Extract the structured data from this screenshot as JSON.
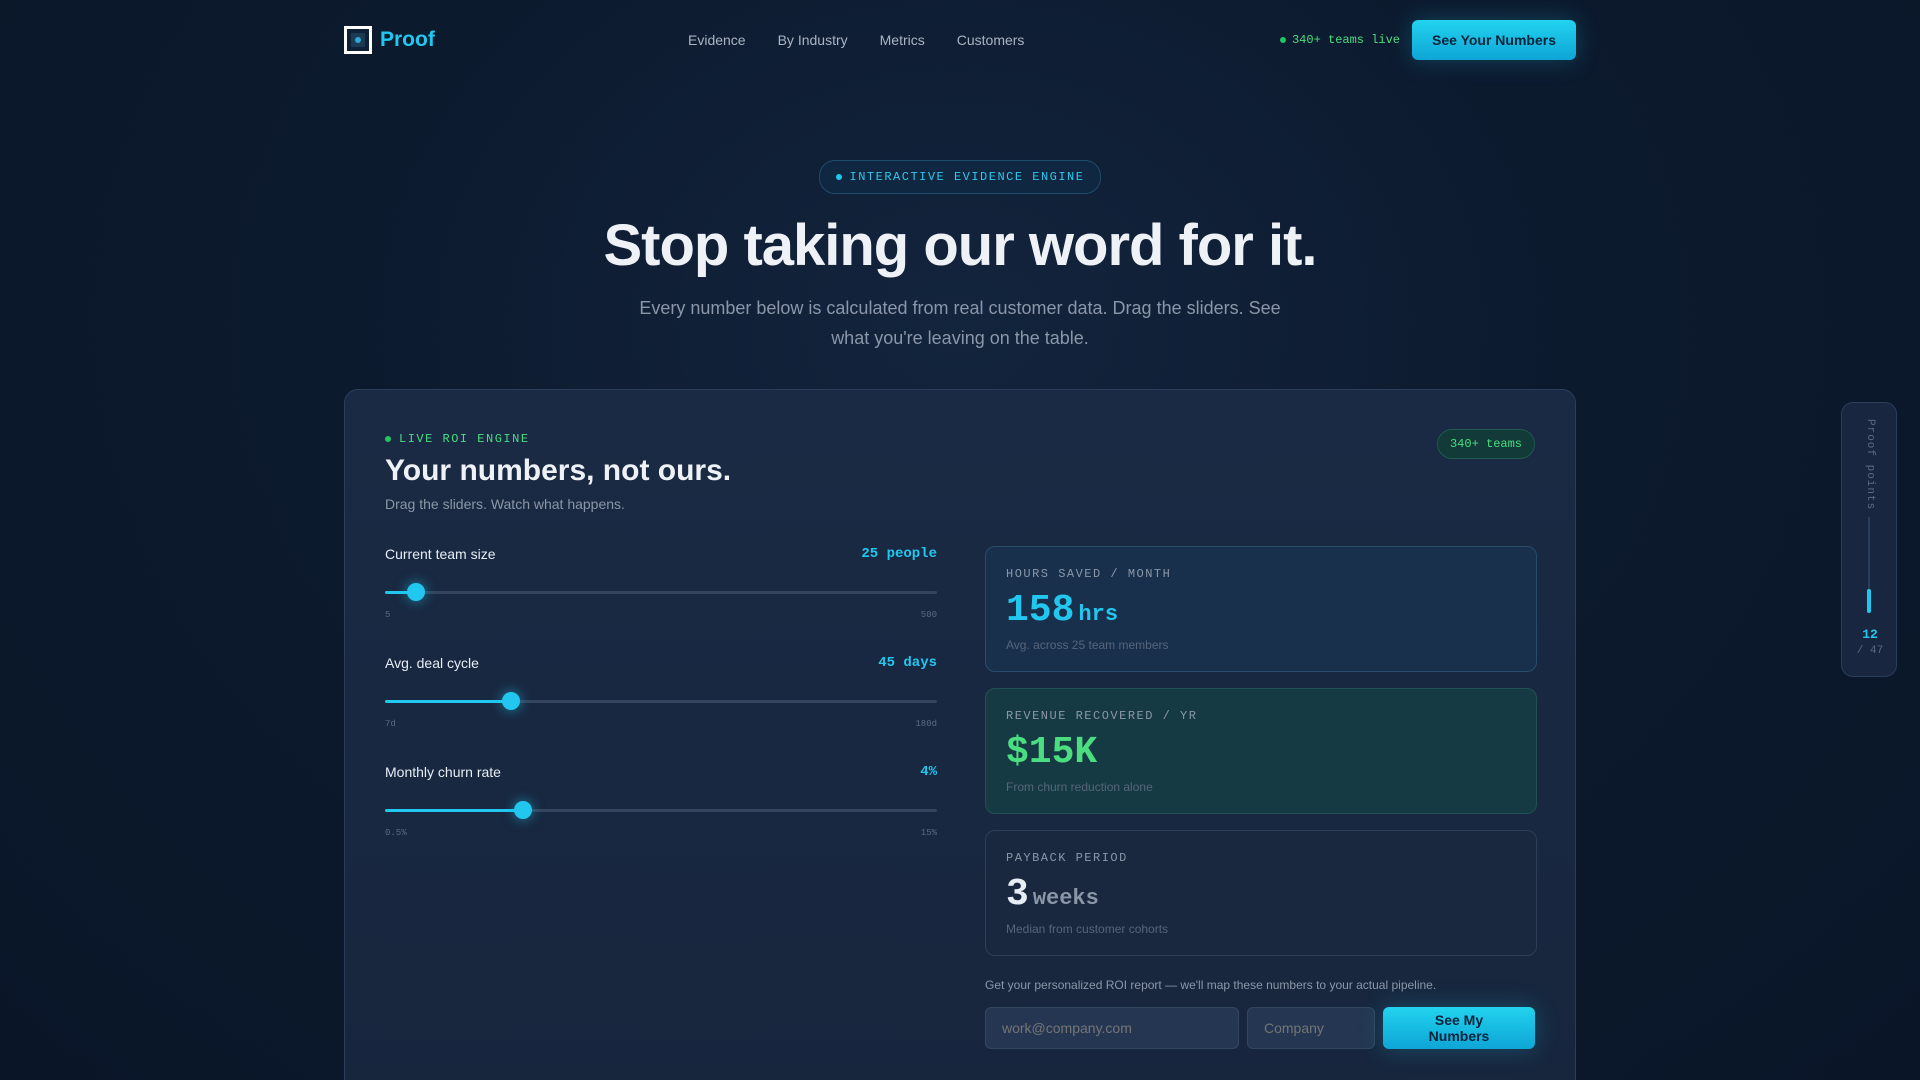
{
  "nav": {
    "brand": "Proof",
    "links": [
      "Evidence",
      "By Industry",
      "Metrics",
      "Customers"
    ],
    "live_text": "340+ teams live",
    "cta_label": "See Your Numbers"
  },
  "hero": {
    "badge": "INTERACTIVE EVIDENCE ENGINE",
    "title": "Stop taking our word for it.",
    "subtitle": "Every number below is calculated from real customer data. Drag the sliders. See what you're leaving on the table."
  },
  "roi": {
    "engine_label": "LIVE ROI ENGINE",
    "title": "Your numbers, not ours.",
    "subtitle": "Drag the sliders. Watch what happens.",
    "teams_badge": "340+ teams",
    "sliders": [
      {
        "label": "Current team size",
        "value_text": "25 people",
        "min_label": "5",
        "max_label": "500",
        "fraction": 0.056
      },
      {
        "label": "Avg. deal cycle",
        "value_text": "45 days",
        "min_label": "7d",
        "max_label": "180d",
        "fraction": 0.228
      },
      {
        "label": "Monthly churn rate",
        "value_text": "4%",
        "min_label": "0.5%",
        "max_label": "15%",
        "fraction": 0.25
      }
    ],
    "metrics": [
      {
        "label": "HOURS SAVED / MONTH",
        "value": "158",
        "unit": "hrs",
        "note": "Avg. across 25 team members",
        "color": "#22c7f0"
      },
      {
        "label": "REVENUE RECOVERED / YR",
        "value": "$15K",
        "unit": "",
        "note": "From churn reduction alone",
        "color": "#4ade80"
      },
      {
        "label": "PAYBACK PERIOD",
        "value": "3",
        "unit": "weeks",
        "note": "Median from customer cohorts",
        "color": "#e6edf5"
      }
    ],
    "cta_note": "Get your personalized ROI report — we'll map these numbers to your actual pipeline.",
    "email_placeholder": "work@company.com",
    "company_placeholder": "Company",
    "cta_label": "See My Numbers"
  },
  "rail": {
    "label": "Proof points",
    "current": "12",
    "total": "/ 47",
    "progress": 0.255
  }
}
